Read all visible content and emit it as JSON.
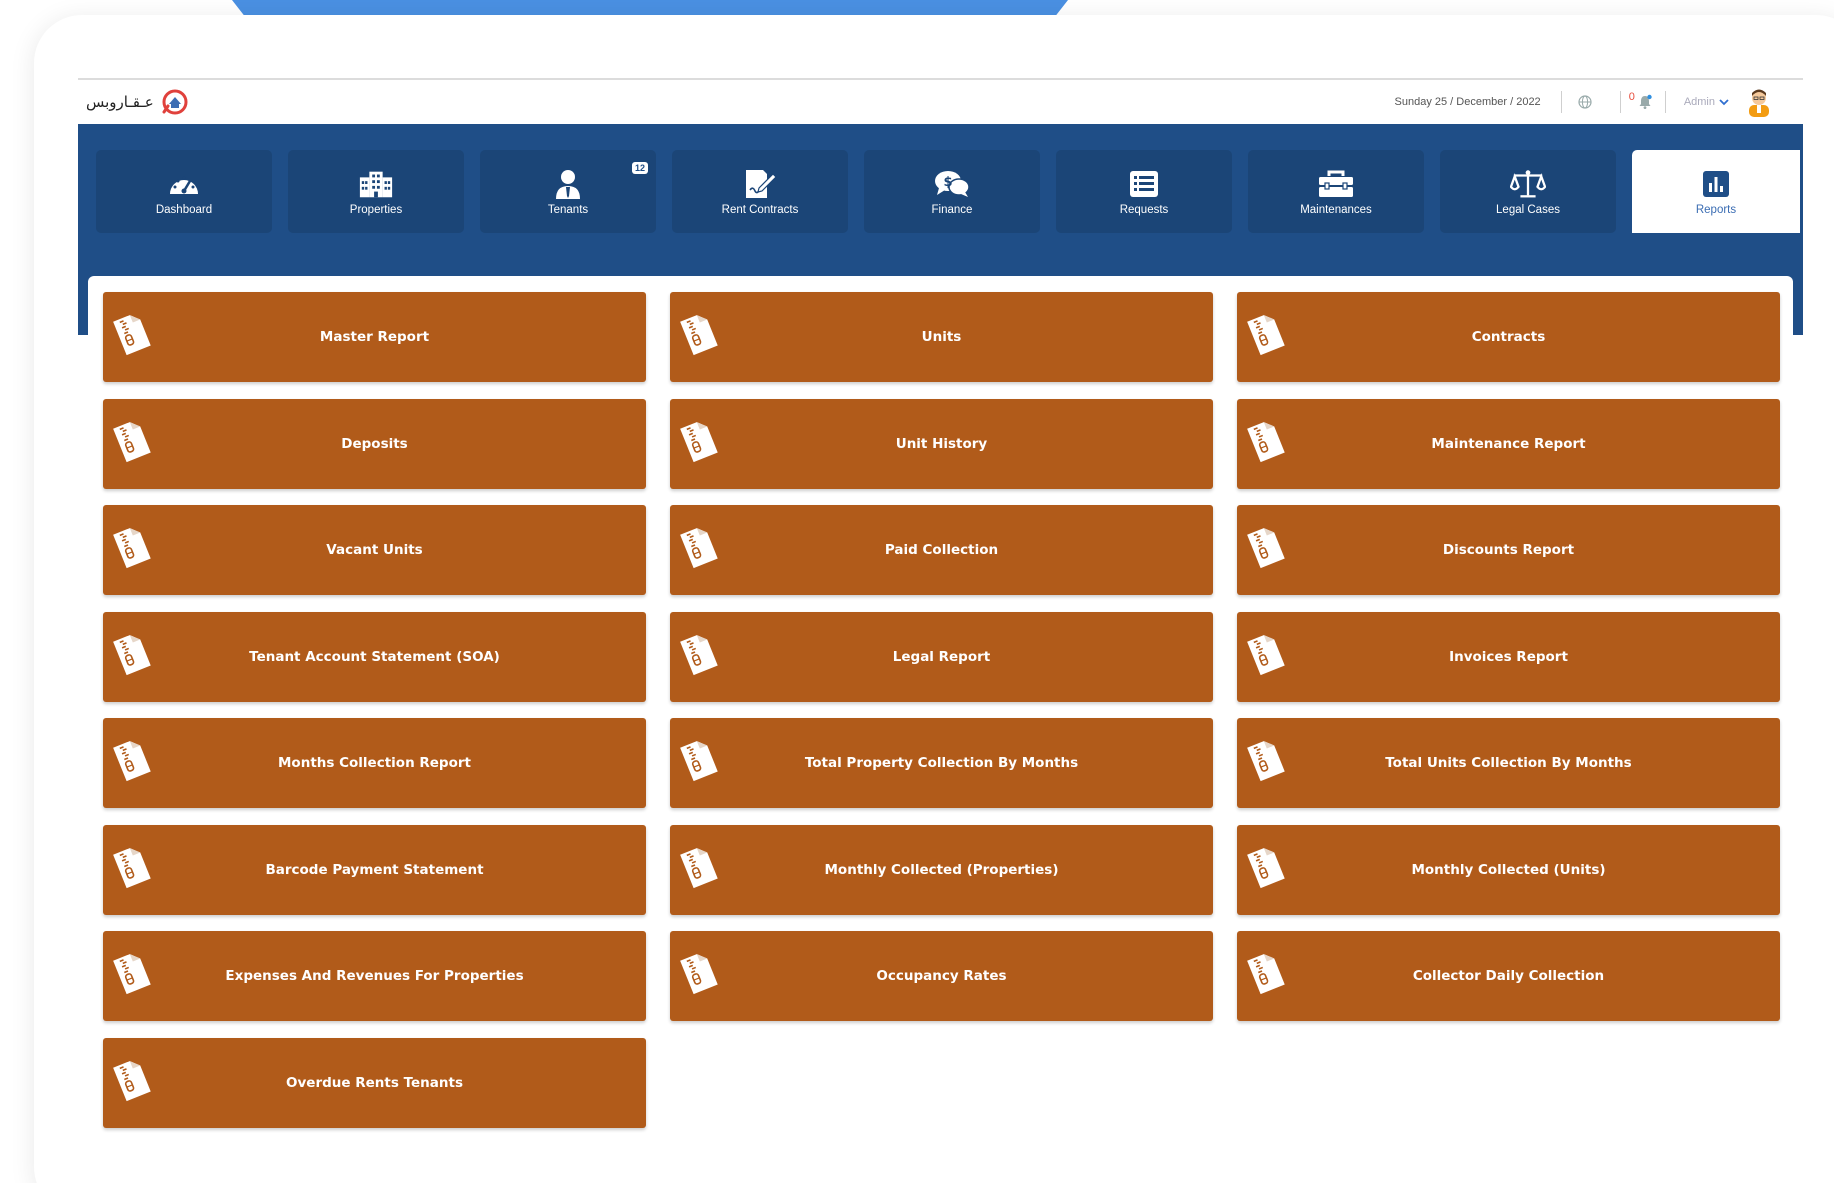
{
  "header": {
    "logo_text": "عـقـاروبس",
    "date": "Sunday 25 / December / 2022",
    "notification_count": "0",
    "user_name": "Admin"
  },
  "nav": {
    "items": [
      {
        "label": "Dashboard",
        "icon": "speedometer-icon"
      },
      {
        "label": "Properties",
        "icon": "building-icon"
      },
      {
        "label": "Tenants",
        "icon": "person-icon",
        "badge": "12"
      },
      {
        "label": "Rent Contracts",
        "icon": "contract-pen-icon"
      },
      {
        "label": "Finance",
        "icon": "dollar-chat-icon"
      },
      {
        "label": "Requests",
        "icon": "list-icon"
      },
      {
        "label": "Maintenances",
        "icon": "toolbox-icon"
      },
      {
        "label": "Legal Cases",
        "icon": "scales-icon"
      },
      {
        "label": "Reports",
        "icon": "bar-chart-icon",
        "active": true
      }
    ]
  },
  "reports": {
    "items": [
      "Master Report",
      "Units",
      "Contracts",
      "Deposits",
      "Unit History",
      "Maintenance Report",
      "Vacant Units",
      "Paid Collection",
      "Discounts Report",
      "Tenant Account Statement (SOA)",
      "Legal Report",
      "Invoices Report",
      "Months Collection Report",
      "Total Property Collection By Months",
      "Total Units Collection By Months",
      "Barcode Payment Statement",
      "Monthly Collected (Properties)",
      "Monthly Collected (Units)",
      "Expenses And Revenues For Properties",
      "Occupancy Rates",
      "Collector Daily Collection",
      "Overdue Rents Tenants"
    ]
  },
  "colors": {
    "nav_band": "#1f4e87",
    "nav_item": "#1b4577",
    "report_button": "#b15b1a",
    "top_accent": "#4a90e2"
  }
}
